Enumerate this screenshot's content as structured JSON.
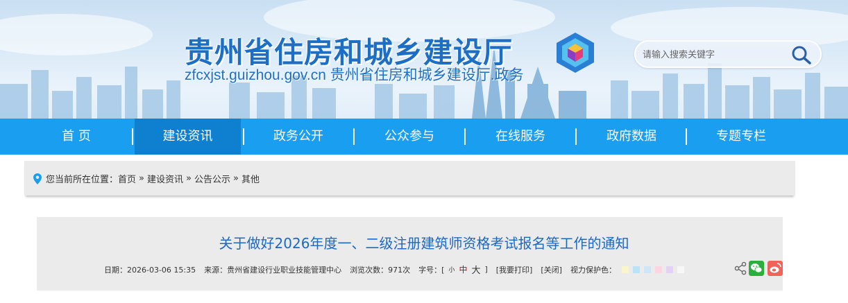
{
  "header": {
    "title": "贵州省住房和城乡建设厅",
    "subtitle": "zfcxjst.guizhou.gov.cn 贵州省住房和城乡建设厅.政务",
    "search_placeholder": "请输入搜索关键字"
  },
  "nav": {
    "items": [
      {
        "label": "首 页"
      },
      {
        "label": "建设资讯",
        "active": true
      },
      {
        "label": "政务公开"
      },
      {
        "label": "公众参与"
      },
      {
        "label": "在线服务"
      },
      {
        "label": "政府数据"
      },
      {
        "label": "专题专栏"
      }
    ]
  },
  "breadcrumb": {
    "prefix": "您当前所在位置：",
    "items": [
      "首页",
      "建设资讯",
      "公告公示",
      "其他"
    ],
    "sep": "»"
  },
  "article": {
    "title": "关于做好2026年度一、二级注册建筑师资格考试报名等工作的通知",
    "date": "日期：2026-03-06 15:35",
    "source": "来源：贵州省建设行业职业技能管理中心",
    "views": "浏览次数：971次",
    "font_label": "字号：[",
    "font_small": "小",
    "font_medium": "中",
    "font_large": "大",
    "font_close": "]",
    "print": "[我要打印]",
    "close": "[关闭]",
    "eye_label": "视力保护色：",
    "eye_colors": [
      "#fbf6c9",
      "#b9e3f6",
      "#cfe6f8",
      "#fbd5e2",
      "#e3d2f5",
      "#f7f7f7"
    ]
  },
  "colors": {
    "accent": "#1a9ef0",
    "nav_active": "#0f7fd0",
    "title_blue": "#1a69c4",
    "wechat": "#2aae3c",
    "weibo": "#f0635a"
  },
  "icons": {
    "search": "search-icon",
    "location": "location-pin-icon",
    "share": "share-icon",
    "wechat": "wechat-icon",
    "weibo": "weibo-icon"
  }
}
